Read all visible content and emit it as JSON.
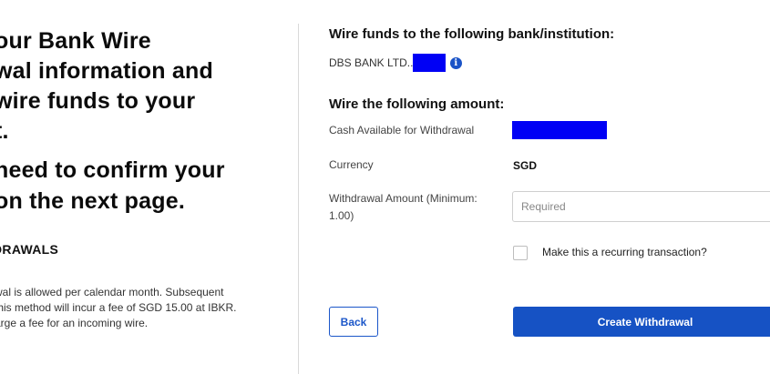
{
  "instructions": {
    "lines": [
      "our Bank Wire",
      "wal information and",
      "wire funds to your",
      "t."
    ],
    "confirm_lines": [
      "need to confirm your",
      "on the next page."
    ]
  },
  "withdrawals": {
    "heading": "DRAWALS",
    "note_lines": [
      "wal is allowed per calendar month. Subsequent",
      "this method will incur a fee of SGD 15.00 at IBKR.",
      "arge a fee for an incoming wire."
    ]
  },
  "bank": {
    "heading": "Wire funds to the following bank/institution:",
    "name": "DBS BANK LTD...",
    "info_icon": "info-icon"
  },
  "amount": {
    "heading": "Wire the following amount:",
    "cash_label": "Cash Available for Withdrawal",
    "currency_label": "Currency",
    "currency_value": "SGD",
    "withdrawal_label": "Withdrawal Amount (Minimum: 1.00)",
    "withdrawal_placeholder": "Required",
    "recurring_label": "Make this a recurring transaction?"
  },
  "actions": {
    "back_label": "Back",
    "create_label": "Create Withdrawal"
  },
  "colors": {
    "primary": "#1652c4",
    "redaction": "#0000f5"
  }
}
